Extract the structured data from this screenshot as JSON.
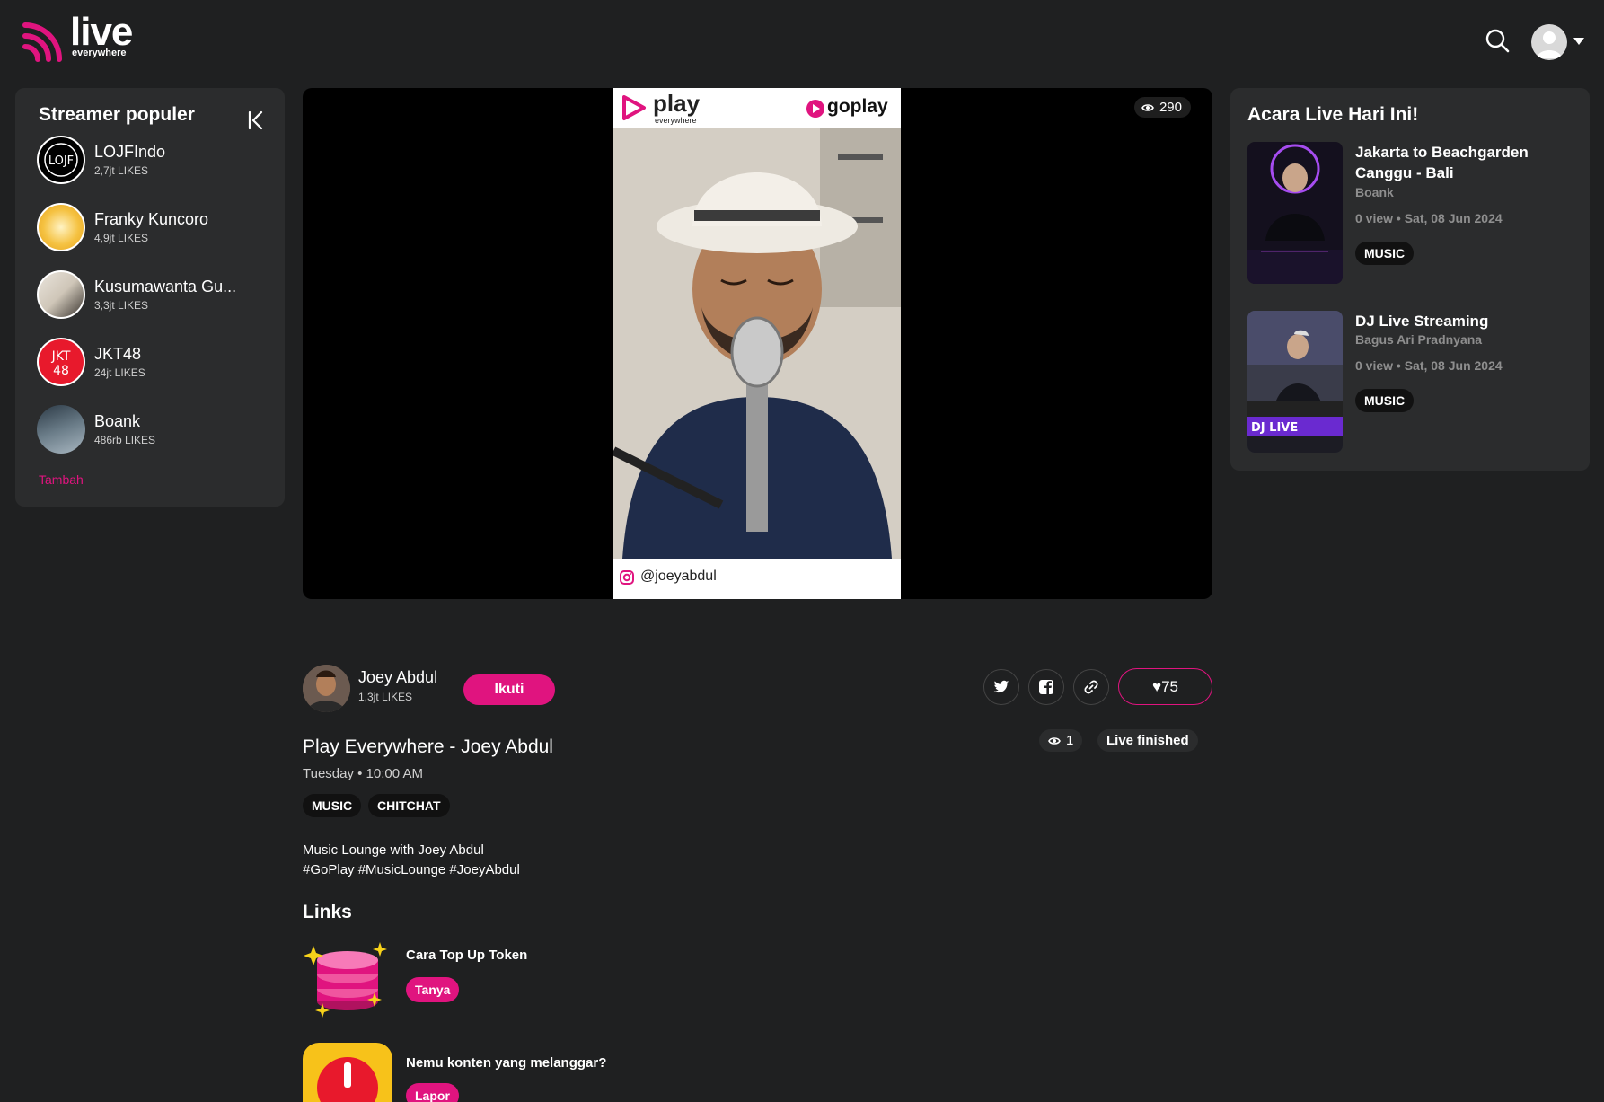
{
  "header": {
    "logo_word": "live",
    "logo_sub": "everywhere",
    "search_icon": "search-icon",
    "avatar_icon": "user-avatar-icon"
  },
  "left_panel": {
    "title": "Streamer populer",
    "more_label": "Tambah",
    "streamers": [
      {
        "name": "LOJFIndo",
        "likes": "2,7jt LIKES"
      },
      {
        "name": "Franky Kuncoro",
        "likes": "4,9jt LIKES"
      },
      {
        "name": "Kusumawanta Gu...",
        "likes": "3,3jt LIKES"
      },
      {
        "name": "JKT48",
        "likes": "24jt LIKES"
      },
      {
        "name": "Boank",
        "likes": "486rb LIKES"
      }
    ]
  },
  "video": {
    "view_count": "290",
    "overlay_brand_left": "play",
    "overlay_brand_left_sub": "everywhere",
    "overlay_brand_right": "goplay",
    "overlay_handle": "@joeyabdul"
  },
  "stream": {
    "host_name": "Joey Abdul",
    "host_likes": "1,3jt LIKES",
    "follow_label": "Ikuti",
    "like_count": "♥75",
    "viewers": "1",
    "status": "Live finished",
    "title": "Play Everywhere - Joey Abdul",
    "time": "Tuesday • 10:00 AM",
    "tags": [
      "MUSIC",
      "CHITCHAT"
    ],
    "description_line1": "Music Lounge with Joey Abdul",
    "description_line2": "#GoPlay #MusicLounge #JoeyAbdul"
  },
  "links": {
    "title": "Links",
    "items": [
      {
        "label": "Cara Top Up Token",
        "button": "Tanya"
      },
      {
        "label": "Nemu konten yang melanggar?",
        "button": "Lapor"
      }
    ]
  },
  "right_panel": {
    "title": "Acara Live Hari Ini!",
    "events": [
      {
        "title": "Jakarta to Beachgarden Canggu - Bali",
        "host": "Boank",
        "meta": "0 view • Sat, 08 Jun 2024",
        "tag": "MUSIC"
      },
      {
        "title": "DJ Live Streaming",
        "host": "Bagus Ari Pradnyana",
        "meta": "0 view • Sat, 08 Jun 2024",
        "tag": "MUSIC"
      }
    ]
  },
  "colors": {
    "accent": "#e0147f",
    "background": "#1f2021",
    "panel": "#2b2c2d"
  }
}
